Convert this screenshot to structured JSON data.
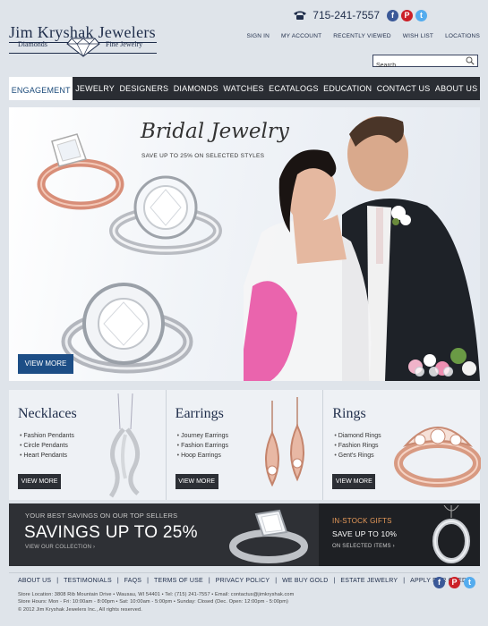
{
  "logo": {
    "name": "Jim Kryshak Jewelers",
    "left_tag": "Diamonds",
    "right_tag": "Fine Jewelry"
  },
  "phone": "715-241-7557",
  "social": {
    "facebook": "f",
    "pinterest": "P",
    "twitter": "t"
  },
  "top_nav": [
    "SIGN IN",
    "MY ACCOUNT",
    "RECENTLY VIEWED",
    "WISH LIST",
    "LOCATIONS"
  ],
  "search": {
    "placeholder": "Search",
    "value": "Search"
  },
  "main_nav": [
    {
      "label": "ENGAGEMENT",
      "active": true
    },
    {
      "label": "JEWELRY",
      "active": false
    },
    {
      "label": "DESIGNERS",
      "active": false
    },
    {
      "label": "DIAMONDS",
      "active": false
    },
    {
      "label": "WATCHES",
      "active": false
    },
    {
      "label": "ECATALOGS",
      "active": false
    },
    {
      "label": "EDUCATION",
      "active": false
    },
    {
      "label": "CONTACT US",
      "active": false
    },
    {
      "label": "ABOUT US",
      "active": false
    }
  ],
  "hero": {
    "title": "Bridal Jewelry",
    "subtitle": "SAVE UP TO 25% ON SELECTED STYLES",
    "button": "VIEW MORE",
    "slides": 3,
    "active_slide": 1
  },
  "categories": [
    {
      "title": "Necklaces",
      "items": [
        "Fashion Pendants",
        "Circle Pendants",
        "Heart Pendants"
      ],
      "button": "VIEW MORE"
    },
    {
      "title": "Earrings",
      "items": [
        "Journey Earrings",
        "Fashion Earrings",
        "Hoop Earrings"
      ],
      "button": "VIEW MORE"
    },
    {
      "title": "Rings",
      "items": [
        "Diamond Rings",
        "Fashion Rings",
        "Gent's Rings"
      ],
      "button": "VIEW MORE"
    }
  ],
  "promo_left": {
    "kicker": "YOUR BEST SAVINGS ON OUR TOP SELLERS",
    "headline": "SAVINGS UP TO 25%",
    "link": "VIEW OUR COLLECTION ›"
  },
  "promo_right": {
    "kicker": "IN-STOCK GIFTS",
    "headline": "SAVE UP TO 10%",
    "link": "ON SELECTED ITEMS ›"
  },
  "footer": {
    "links": [
      "ABOUT US",
      "TESTIMONIALS",
      "FAQS",
      "TERMS OF USE",
      "PRIVACY POLICY",
      "WE BUY GOLD",
      "ESTATE JEWELRY",
      "APPLY FOR CREDIT"
    ],
    "location": "Store Location: 3808 Rib Mountain Drive • Wausau,  WI  54401 • Tel: (715) 241-7557 • Email: contactus@jimkryshak.com",
    "hours": "Store Hours: Mon - Fri: 10:00am - 8:00pm • Sat: 10:00am - 5:00pm • Sunday: Closed (Dec. Open: 12:00pm - 5:00pm)",
    "copyright": "© 2012 Jim Kryshak Jewelers Inc., All rights reserved."
  },
  "colors": {
    "navy": "#1f2d4a",
    "nav_bg": "#2a2d33",
    "button_blue": "#1d4e86",
    "accent_orange": "#e79a5a",
    "facebook": "#3b5998",
    "pinterest": "#cb2027",
    "twitter": "#55acee"
  },
  "icons": [
    "phone-icon",
    "facebook-icon",
    "pinterest-icon",
    "twitter-icon",
    "search-icon",
    "diamond-icon"
  ]
}
